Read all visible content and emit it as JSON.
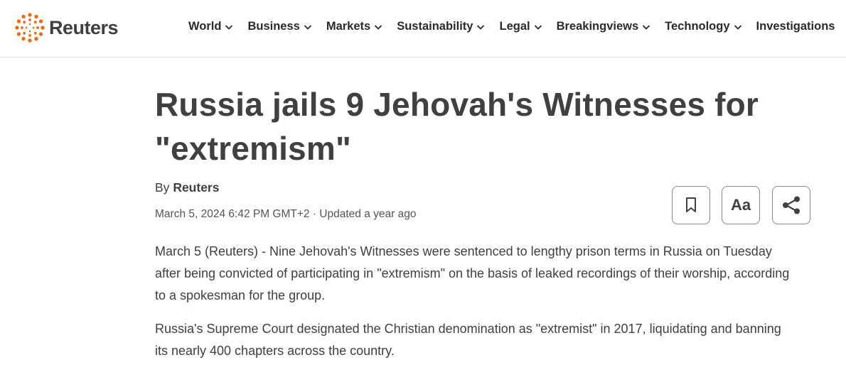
{
  "brand": {
    "name": "Reuters",
    "accent_color": "#fa6400",
    "logo_icon": "reuters-dot-ring-logo"
  },
  "nav": {
    "items": [
      {
        "label": "World",
        "has_dropdown": true
      },
      {
        "label": "Business",
        "has_dropdown": true
      },
      {
        "label": "Markets",
        "has_dropdown": true
      },
      {
        "label": "Sustainability",
        "has_dropdown": true
      },
      {
        "label": "Legal",
        "has_dropdown": true
      },
      {
        "label": "Breakingviews",
        "has_dropdown": true
      },
      {
        "label": "Technology",
        "has_dropdown": true
      },
      {
        "label": "Investigations",
        "has_dropdown": false
      }
    ]
  },
  "article": {
    "title": "Russia jails 9 Jehovah's Witnesses for \"extremism\"",
    "byline_prefix": "By",
    "byline_author": "Reuters",
    "dateline": "March 5, 2024 6:42 PM GMT+2 · Updated a year ago",
    "paragraphs": [
      "March 5 (Reuters) - Nine Jehovah's Witnesses were sentenced to lengthy prison terms in Russia on Tuesday after being convicted of participating in \"extremism\" on the basis of leaked recordings of their worship, according to a spokesman for the group.",
      "Russia's Supreme Court designated the Christian denomination as \"extremist\" in 2017, liquidating and banning its nearly 400 chapters across the country."
    ]
  },
  "tools": {
    "bookmark_icon": "bookmark-icon",
    "text_size_label": "Aa",
    "share_icon": "share-icon"
  }
}
